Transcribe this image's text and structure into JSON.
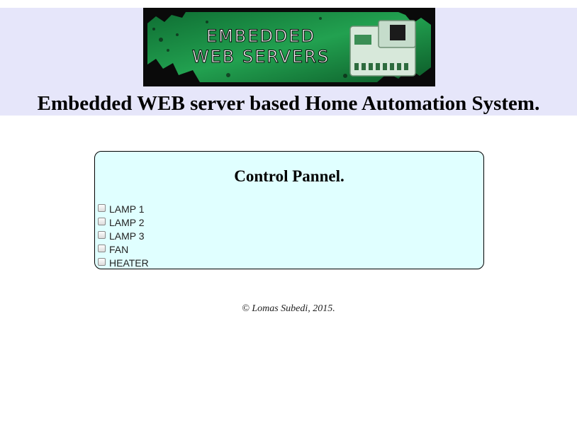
{
  "header": {
    "banner": {
      "line1": "EMBEDDED",
      "line2": "WEB SERVERS",
      "background_color": "#1f9a4a",
      "text_color": "#ffffff"
    },
    "title": "Embedded WEB server based Home Automation System."
  },
  "panel": {
    "title": "Control Pannel.",
    "background_color": "#e0ffff",
    "devices": [
      {
        "label": "LAMP 1",
        "checked": false
      },
      {
        "label": "LAMP 2",
        "checked": false
      },
      {
        "label": "LAMP 3",
        "checked": false
      },
      {
        "label": "FAN",
        "checked": false
      },
      {
        "label": "HEATER",
        "checked": false
      }
    ]
  },
  "footer": {
    "copyright": "© Lomas Subedi, 2015."
  }
}
